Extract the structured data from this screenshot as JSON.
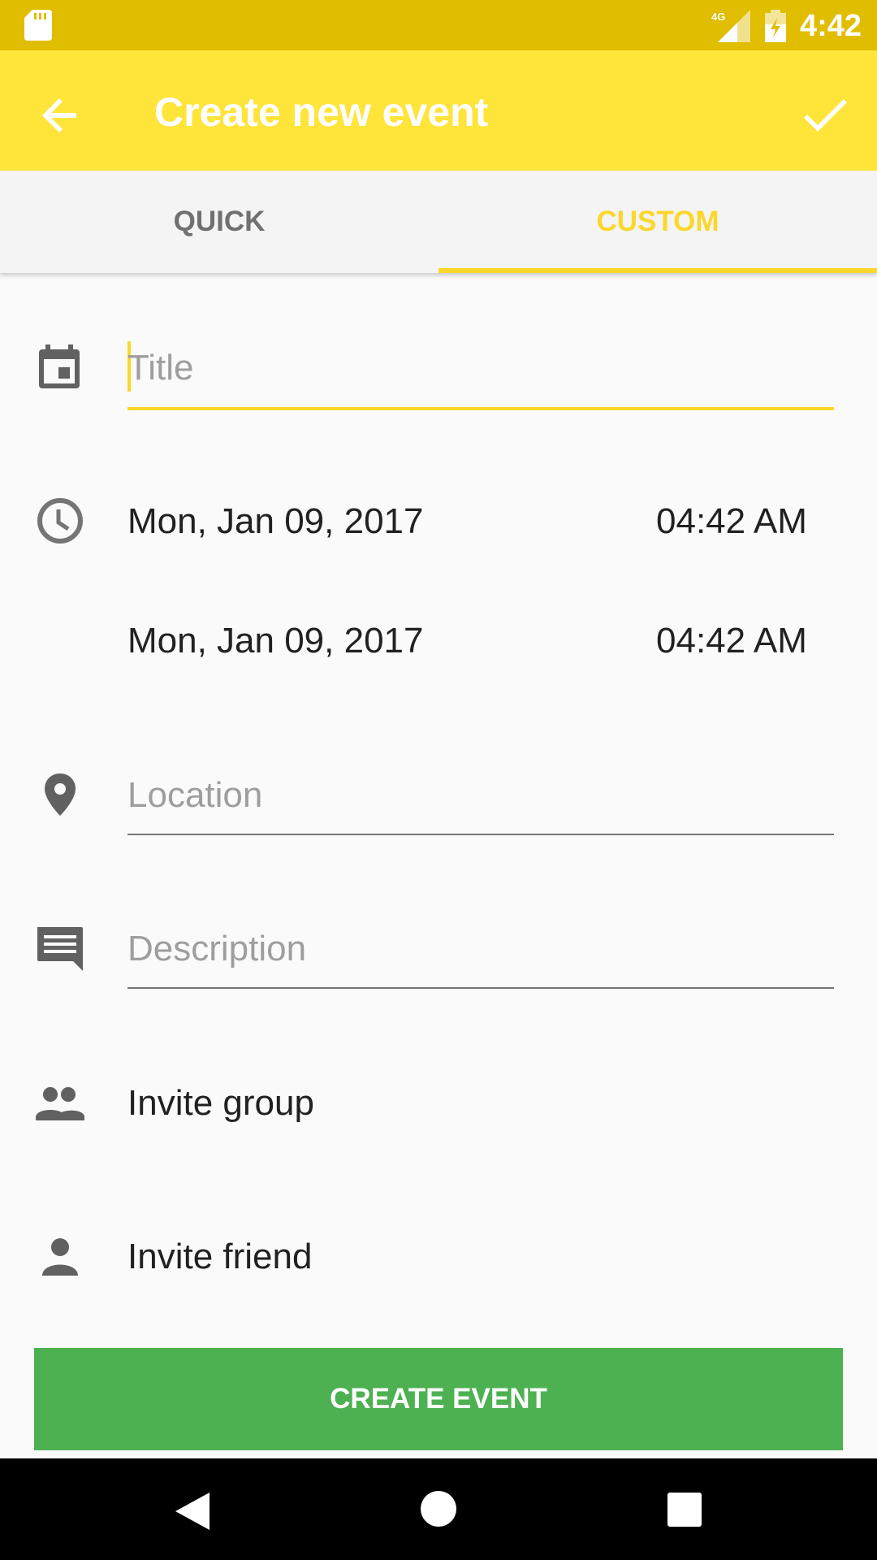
{
  "status_bar": {
    "network_label": "4G",
    "time": "4:42",
    "background_color": "#e1bd00"
  },
  "app_bar": {
    "title": "Create new event",
    "back_icon": "arrow-back-icon",
    "confirm_icon": "check-icon",
    "background_color": "#ffe43a"
  },
  "tabs": [
    {
      "label": "QUICK",
      "selected": false
    },
    {
      "label": "CUSTOM",
      "selected": true
    }
  ],
  "accent_color": "#fbd72b",
  "form": {
    "title_placeholder": "Title",
    "start_date": "Mon, Jan 09, 2017",
    "start_time": "04:42 AM",
    "end_date": "Mon, Jan 09, 2017",
    "end_time": "04:42 AM",
    "location_placeholder": "Location",
    "description_placeholder": "Description",
    "invite_group_label": "Invite group",
    "invite_friend_label": "Invite friend"
  },
  "create_button": {
    "label": "CREATE EVENT",
    "color": "#4db152"
  },
  "icons": [
    "calendar-icon",
    "clock-icon",
    "location-pin-icon",
    "comment-icon",
    "group-icon",
    "person-icon"
  ]
}
